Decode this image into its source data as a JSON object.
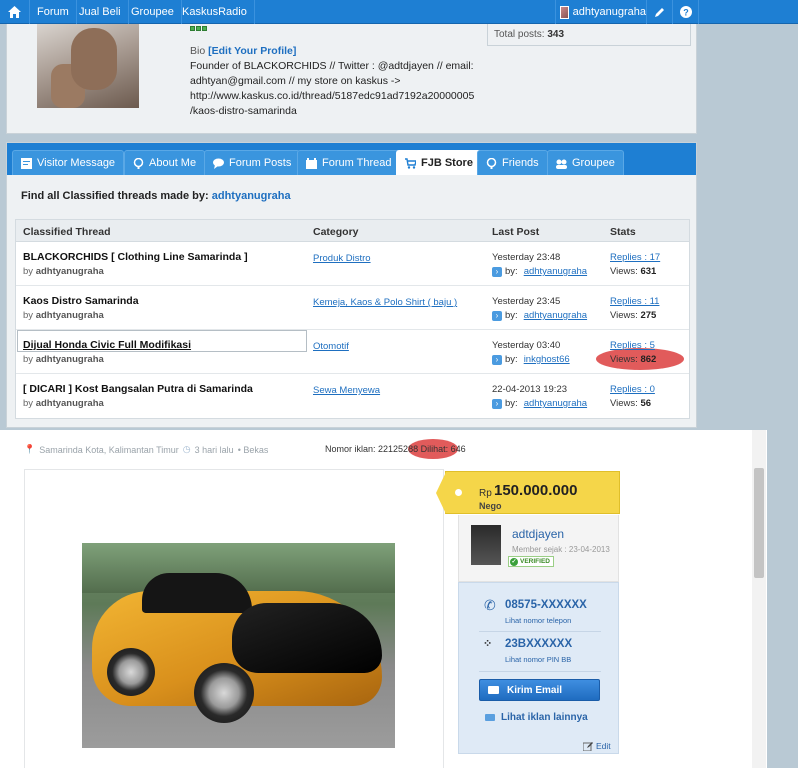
{
  "nav": {
    "items": [
      "Forum",
      "Jual Beli",
      "Groupee",
      "KaskusRadio"
    ],
    "username": "adhtyanugraha"
  },
  "profile": {
    "bio_label": "Bio",
    "edit_profile": "[Edit Your Profile]",
    "bio_lines": [
      "Founder of BLACKORCHIDS // Twitter : @adtdjayen // email:",
      "adhtyan@gmail.com // my store on kaskus ->",
      "http://www.kaskus.co.id/thread/5187edc91ad7192a20000005",
      "/kaos-distro-samarinda"
    ],
    "total_posts_label": "Total posts:",
    "total_posts": "343"
  },
  "tabs": [
    {
      "label": "Visitor Message",
      "icon": "message-icon"
    },
    {
      "label": "About Me",
      "icon": "info-icon"
    },
    {
      "label": "Forum Posts",
      "icon": "chat-icon"
    },
    {
      "label": "Forum Thread",
      "icon": "thread-icon"
    },
    {
      "label": "FJB Store",
      "icon": "cart-icon"
    },
    {
      "label": "Friends",
      "icon": "friends-icon"
    },
    {
      "label": "Groupee",
      "icon": "group-icon"
    }
  ],
  "find": {
    "text": "Find all Classified threads made by:",
    "user": "adhtyanugraha"
  },
  "table": {
    "headers": [
      "Classified Thread",
      "Category",
      "Last Post",
      "Stats"
    ],
    "rows": [
      {
        "title": "BLACKORCHIDS [ Clothing Line Samarinda ]",
        "by": "adhtyanugraha",
        "category": "Produk Distro",
        "last_post": "Yesterday 23:48",
        "last_by": "adhtyanugraha",
        "replies": "Replies : 17",
        "views": "631"
      },
      {
        "title": "Kaos Distro Samarinda",
        "by": "adhtyanugraha",
        "category": "Kemeja, Kaos & Polo Shirt ( baju )",
        "last_post": "Yesterday 23:45",
        "last_by": "adhtyanugraha",
        "replies": "Replies : 11",
        "views": "275"
      },
      {
        "title": "Dijual Honda Civic Full Modifikasi",
        "by": "adhtyanugraha",
        "category": "Otomotif",
        "last_post": "Yesterday 03:40",
        "last_by": "inkghost66",
        "replies": "Replies : 5",
        "views": "862"
      },
      {
        "title": "[ DICARI ] Kost Bangsalan Putra di Samarinda",
        "by": "adhtyanugraha",
        "category": "Sewa Menyewa",
        "last_post": "22-04-2013 19:23",
        "last_by": "adhtyanugraha",
        "replies": "Replies : 0",
        "views": "56"
      }
    ],
    "by_prefix": "by",
    "last_by_prefix": "by:",
    "views_prefix": "Views:"
  },
  "ad": {
    "location": "Samarinda Kota, Kalimantan Timur",
    "time": "3 hari lalu",
    "condition": "• Bekas",
    "nomor_label": "Nomor iklan:",
    "nomor": "22125288",
    "dilihat": "Dilihat: 646",
    "price_currency": "Rp",
    "price": "150.000.000",
    "nego": "Nego",
    "seller_name": "adtdjayen",
    "member_since": "Member sejak : 23-04-2013",
    "verified": "VERIFIED",
    "phone": "08575-XXXXXX",
    "phone_sub": "Lihat nomor telepon",
    "bb_pin": "23BXXXXXX",
    "bb_sub": "Lihat nomor PIN BB",
    "email_btn": "Kirim Email",
    "more_ads": "Lihat iklan lainnya",
    "edit": "Edit"
  }
}
